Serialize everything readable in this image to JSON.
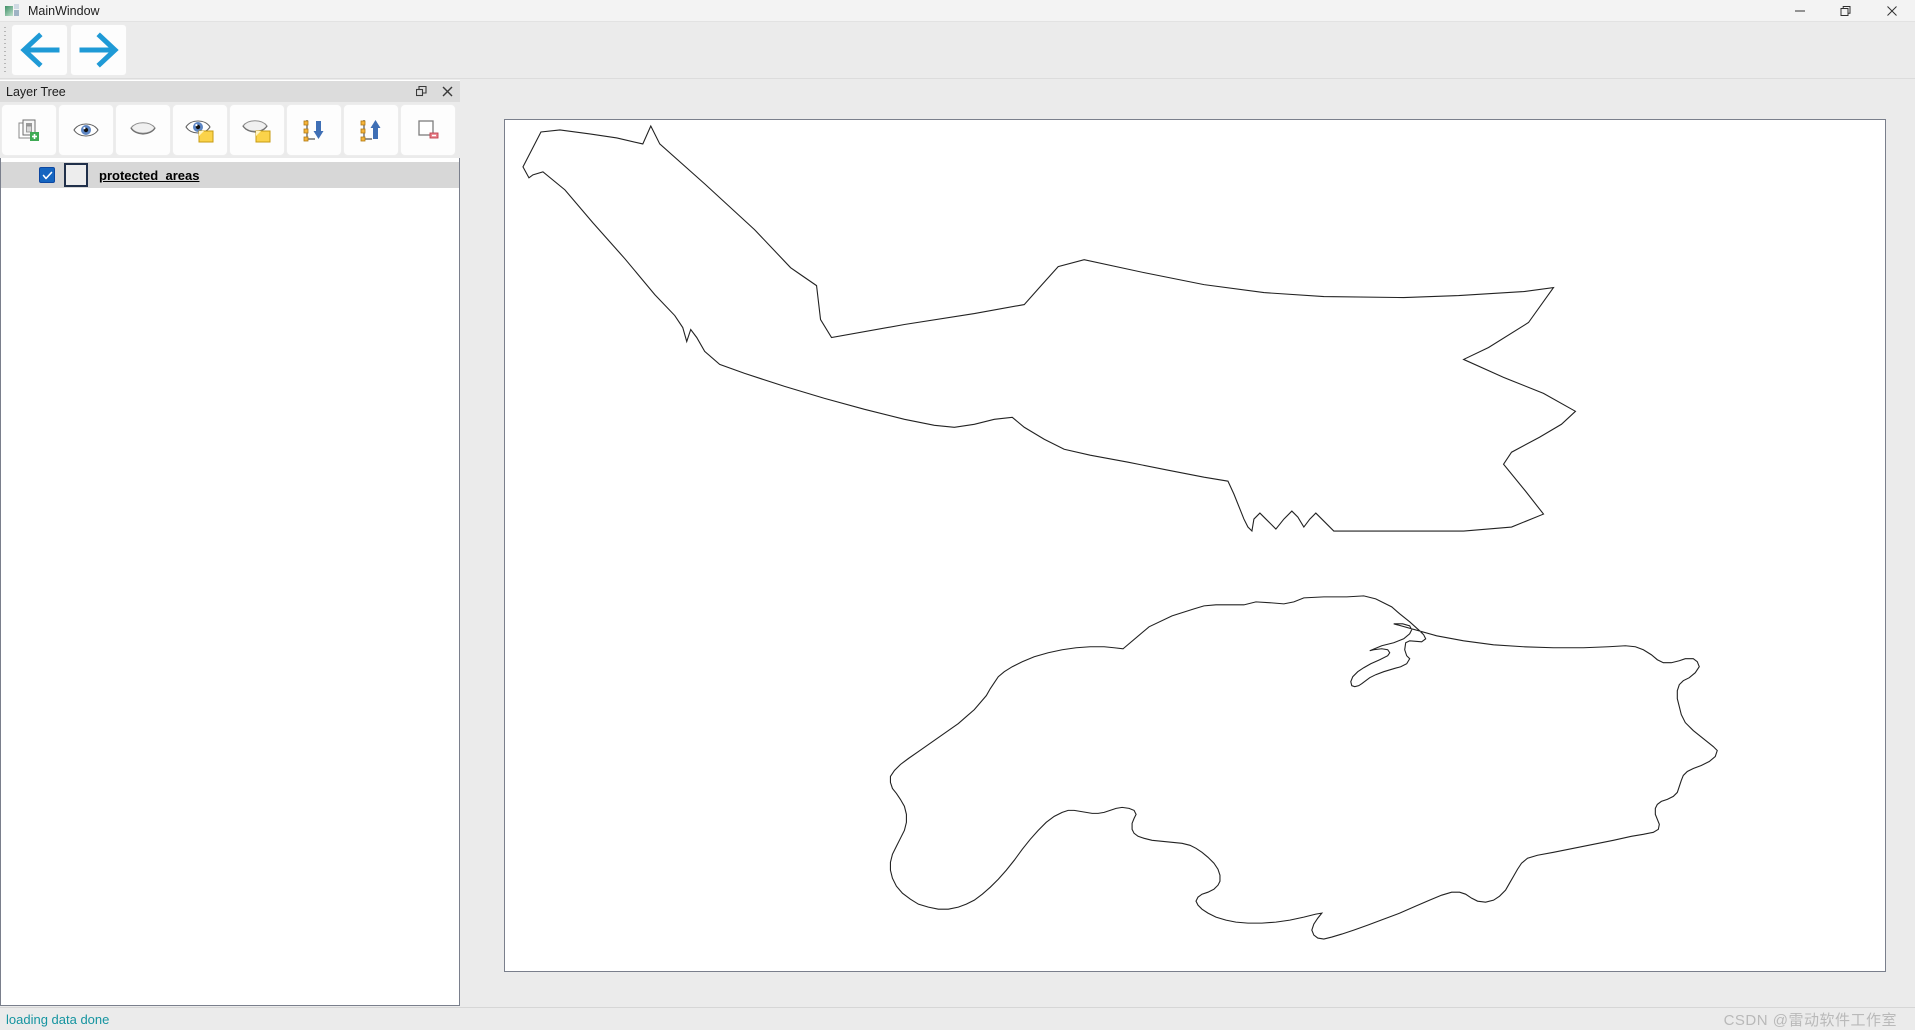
{
  "window": {
    "title": "MainWindow",
    "icon": "app-icon",
    "controls": [
      {
        "name": "minimize-button",
        "icon": "minimize-icon",
        "label": "Minimize"
      },
      {
        "name": "restore-button",
        "icon": "restore-icon",
        "label": "Restore"
      },
      {
        "name": "close-button",
        "icon": "close-icon",
        "label": "Close"
      }
    ]
  },
  "nav_toolbar": {
    "accent_color": "#1f9ad6",
    "buttons": [
      {
        "name": "back-button",
        "icon": "arrow-left-icon",
        "label": "Back"
      },
      {
        "name": "forward-button",
        "icon": "arrow-right-icon",
        "label": "Forward"
      }
    ]
  },
  "dock": {
    "title": "Layer Tree",
    "title_buttons": [
      {
        "name": "float-button",
        "icon": "float-icon",
        "label": "Float"
      },
      {
        "name": "close-panel-button",
        "icon": "close-icon",
        "label": "Close"
      }
    ],
    "toolbar": [
      {
        "name": "add-layer-button",
        "icon": "add-layer-icon",
        "label": "Add Layer"
      },
      {
        "name": "show-all-layers-button",
        "icon": "eye-icon",
        "label": "Show All Layers"
      },
      {
        "name": "hide-all-layers-button",
        "icon": "eye-closed-icon",
        "label": "Hide All Layers"
      },
      {
        "name": "show-selected-layers-button",
        "icon": "eye-selected-icon",
        "label": "Show Selected Layers"
      },
      {
        "name": "hide-selected-layers-button",
        "icon": "eye-closed-selected-icon",
        "label": "Hide Selected Layers"
      },
      {
        "name": "move-layer-down-button",
        "icon": "move-down-icon",
        "label": "Move Layer Down"
      },
      {
        "name": "move-layer-up-button",
        "icon": "move-up-icon",
        "label": "Move Layer Up"
      },
      {
        "name": "remove-layer-button",
        "icon": "remove-layer-icon",
        "label": "Remove Layer"
      }
    ],
    "layers": [
      {
        "name": "protected_areas",
        "checked": true,
        "symbol": "polygon-outline-swatch",
        "symbol_fill": "#ededed",
        "symbol_stroke": "#20304a"
      }
    ]
  },
  "map": {
    "background": "#ffffff",
    "stroke_color": "#222222",
    "features": [
      {
        "id": "protected-area-north",
        "name": "northern-polygon"
      },
      {
        "id": "protected-area-south",
        "name": "southern-polygon"
      }
    ]
  },
  "statusbar": {
    "message": "loading data done",
    "message_color": "#1594a0",
    "watermark": "CSDN @雷动软件工作室"
  }
}
